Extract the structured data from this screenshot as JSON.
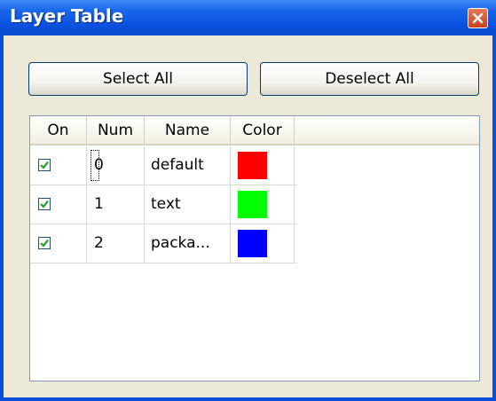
{
  "window": {
    "title": "Layer Table"
  },
  "buttons": {
    "select_all": "Select All",
    "deselect_all": "Deselect All"
  },
  "table": {
    "columns": [
      "On",
      "Num",
      "Name",
      "Color"
    ],
    "rows": [
      {
        "on": true,
        "num": "0",
        "name": "default",
        "color": "#ff0000"
      },
      {
        "on": true,
        "num": "1",
        "name": "text",
        "color": "#00ff00"
      },
      {
        "on": true,
        "num": "2",
        "name": "packa...",
        "color": "#0000ff"
      }
    ]
  }
}
